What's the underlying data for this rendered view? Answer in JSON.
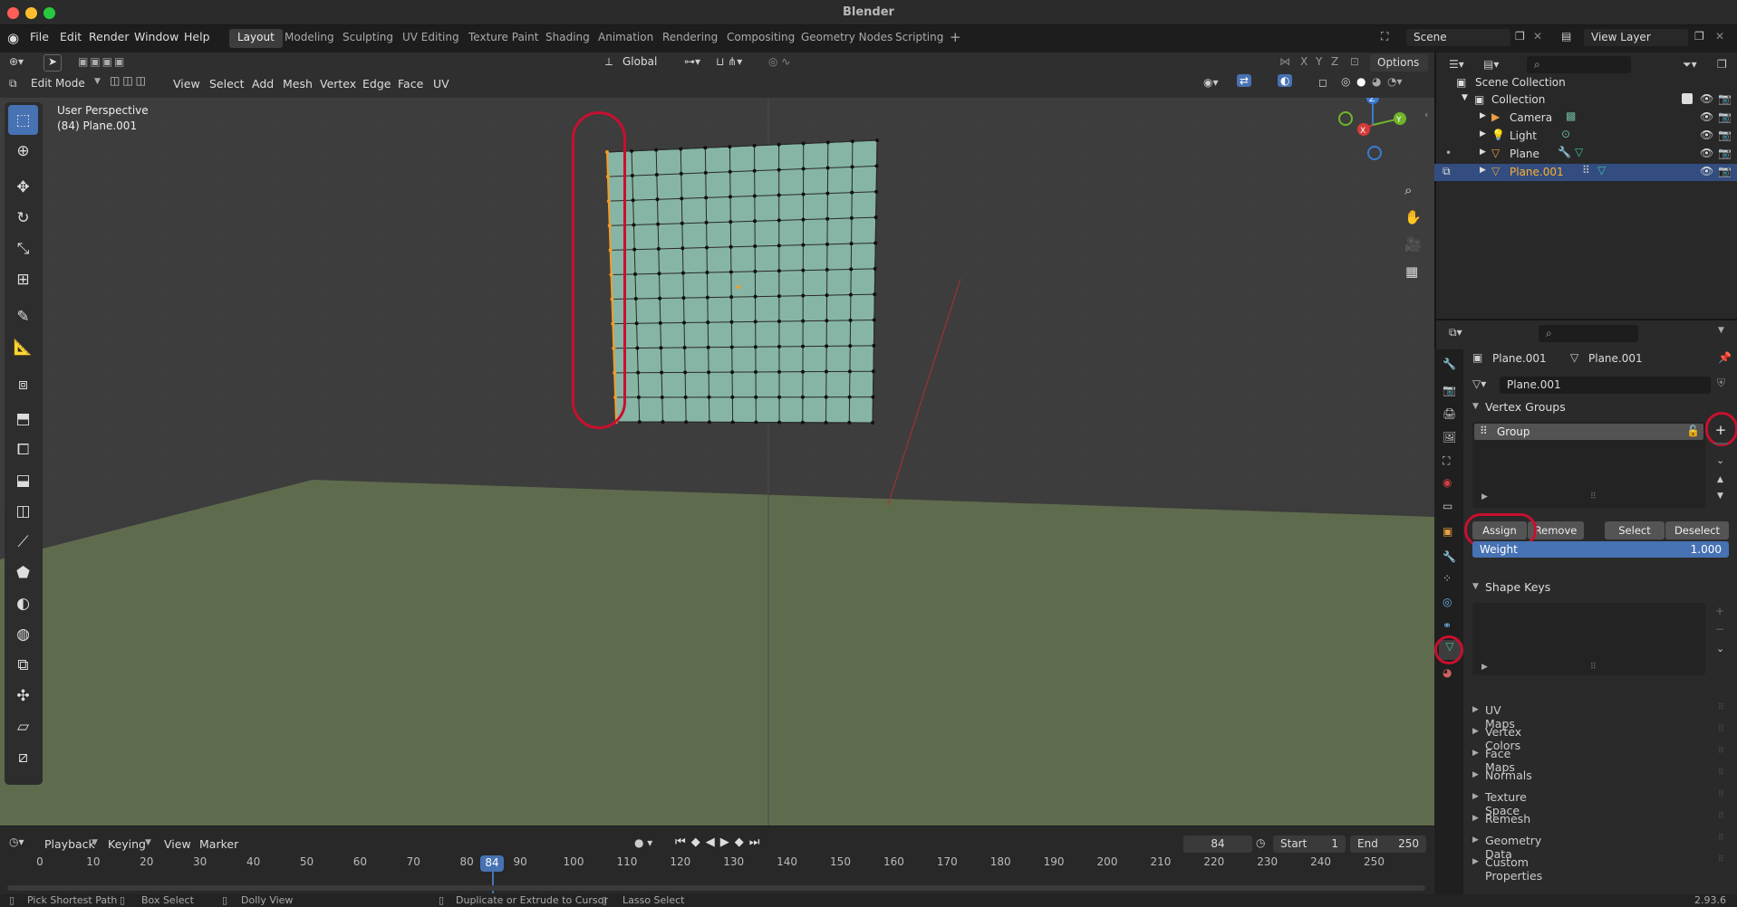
{
  "window": {
    "title": "Blender",
    "version": "2.93.6"
  },
  "menus": [
    "File",
    "Edit",
    "Render",
    "Window",
    "Help"
  ],
  "workspaces": [
    "Layout",
    "Modeling",
    "Sculpting",
    "UV Editing",
    "Texture Paint",
    "Shading",
    "Animation",
    "Rendering",
    "Compositing",
    "Geometry Nodes",
    "Scripting"
  ],
  "active_workspace": "Layout",
  "scene": "Scene",
  "view_layer": "View Layer",
  "viewport": {
    "mode": "Edit Mode",
    "menus": [
      "View",
      "Select",
      "Add",
      "Mesh",
      "Vertex",
      "Edge",
      "Face",
      "UV"
    ],
    "transform_orientation": "Global",
    "options_label": "Options",
    "overlay_line1": "User Perspective",
    "overlay_line2": "(84) Plane.001",
    "gizmo_axes": {
      "x": "X",
      "y": "Y",
      "z": "Z"
    }
  },
  "outliner": {
    "root": "Scene Collection",
    "collection": "Collection",
    "items": [
      {
        "label": "Camera",
        "selected": false
      },
      {
        "label": "Light",
        "selected": false
      },
      {
        "label": "Plane",
        "selected": false
      },
      {
        "label": "Plane.001",
        "selected": true
      }
    ]
  },
  "properties": {
    "breadcrumb_object": "Plane.001",
    "breadcrumb_mesh": "Plane.001",
    "mesh_name": "Plane.001",
    "vertex_groups_title": "Vertex Groups",
    "group_item": "Group",
    "assign_label": "Assign",
    "remove_label": "Remove",
    "select_label": "Select",
    "deselect_label": "Deselect",
    "weight_label": "Weight",
    "weight_value": "1.000",
    "shape_keys_title": "Shape Keys",
    "collapsed_panels": [
      "UV Maps",
      "Vertex Colors",
      "Face Maps",
      "Normals",
      "Texture Space",
      "Remesh",
      "Geometry Data",
      "Custom Properties"
    ]
  },
  "timeline": {
    "menus": [
      "Playback",
      "Keying",
      "View",
      "Marker"
    ],
    "current_frame": "84",
    "start_label": "Start",
    "start_value": "1",
    "end_label": "End",
    "end_value": "250",
    "ticks": [
      "0",
      "10",
      "20",
      "30",
      "40",
      "50",
      "60",
      "70",
      "80",
      "90",
      "100",
      "110",
      "120",
      "130",
      "140",
      "150",
      "160",
      "170",
      "180",
      "190",
      "200",
      "210",
      "220",
      "230",
      "240",
      "250"
    ]
  },
  "statusbar": {
    "item1": "Pick Shortest Path",
    "item2": "Box Select",
    "item3": "Dolly View",
    "item4": "Duplicate or Extrude to Cursor",
    "item5": "Lasso Select"
  },
  "colors": {
    "accent": "#4772b3",
    "mesh_face": "#86b5a5",
    "selected_vertex": "#f39c2a",
    "highlight_circle": "#c8102e",
    "ground": "#5f6b4d"
  }
}
